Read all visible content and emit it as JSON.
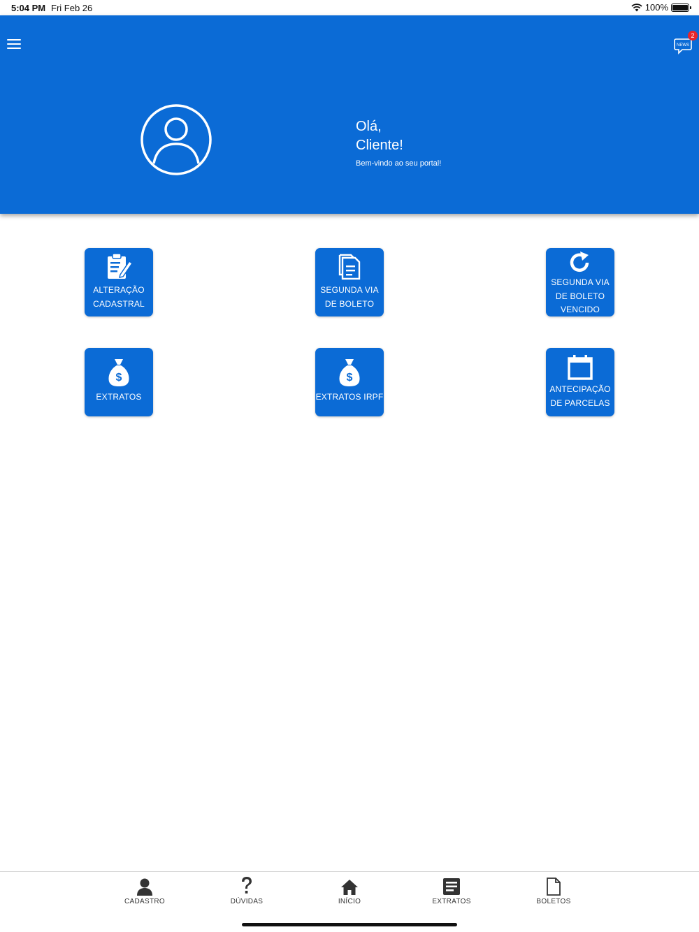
{
  "status_bar": {
    "time": "5:04 PM",
    "date": "Fri Feb 26",
    "battery": "100%"
  },
  "header": {
    "greeting_line1": "Olá,",
    "greeting_line2": "Cliente!",
    "subtitle": "Bem-vindo ao seu portal!",
    "news_icon_text": "NEWS",
    "news_count": "2",
    "bg_color": "#0b6bd6"
  },
  "tiles": [
    {
      "label_lines": [
        "ALTERAÇÃO",
        "CADASTRAL"
      ],
      "icon": "clipboard-edit-icon"
    },
    {
      "label_lines": [
        "SEGUNDA VIA",
        "DE BOLETO"
      ],
      "icon": "documents-icon"
    },
    {
      "label_lines": [
        "SEGUNDA VIA",
        "DE BOLETO",
        "VENCIDO"
      ],
      "icon": "refresh-icon"
    },
    {
      "label_lines": [
        "EXTRATOS"
      ],
      "icon": "money-bag-icon"
    },
    {
      "label_lines": [
        "EXTRATOS IRPF"
      ],
      "icon": "money-bag-icon"
    },
    {
      "label_lines": [
        "ANTECIPAÇÃO",
        "DE PARCELAS"
      ],
      "icon": "calendar-icon"
    }
  ],
  "bottom_nav": [
    {
      "label": "CADASTRO",
      "icon": "person-icon"
    },
    {
      "label": "DÚVIDAS",
      "icon": "question-icon"
    },
    {
      "label": "INÍCIO",
      "icon": "home-icon"
    },
    {
      "label": "EXTRATOS",
      "icon": "list-document-icon"
    },
    {
      "label": "BOLETOS",
      "icon": "file-icon"
    }
  ]
}
